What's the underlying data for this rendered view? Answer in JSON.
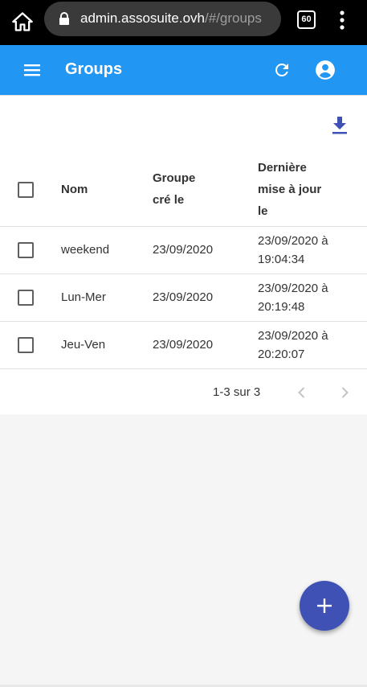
{
  "browser": {
    "url_host": "admin.assosuite.ovh",
    "url_path": "/#/groups",
    "tab_count": "60",
    "icons": {
      "home": "home-icon",
      "lock": "lock-icon",
      "menu": "more-vert-icon"
    }
  },
  "appbar": {
    "title": "Groups",
    "color": "#2196f3",
    "icons": {
      "menu": "hamburger-menu-icon",
      "refresh": "refresh-icon",
      "account": "account-circle-icon"
    }
  },
  "toolbar": {
    "icons": {
      "export": "download-icon"
    },
    "accent": "#3f51b5"
  },
  "table": {
    "headers": {
      "name": "Nom",
      "created_line1": "Groupe",
      "created_line2": "cré le",
      "updated_line1": "Dernière",
      "updated_line2": "mise à jour",
      "updated_line3": "le"
    },
    "rows": [
      {
        "name": "weekend",
        "created": "23/09/2020",
        "updated_line1": "23/09/2020 à",
        "updated_line2": "19:04:34"
      },
      {
        "name": "Lun-Mer",
        "created": "23/09/2020",
        "updated_line1": "23/09/2020 à",
        "updated_line2": "20:19:48"
      },
      {
        "name": "Jeu-Ven",
        "created": "23/09/2020",
        "updated_line1": "23/09/2020 à",
        "updated_line2": "20:20:07"
      }
    ]
  },
  "pagination": {
    "range": "1-3 sur 3",
    "icons": {
      "prev": "chevron-left-icon",
      "next": "chevron-right-icon"
    }
  },
  "fab": {
    "icon": "plus-icon",
    "color": "#3f51b5"
  }
}
